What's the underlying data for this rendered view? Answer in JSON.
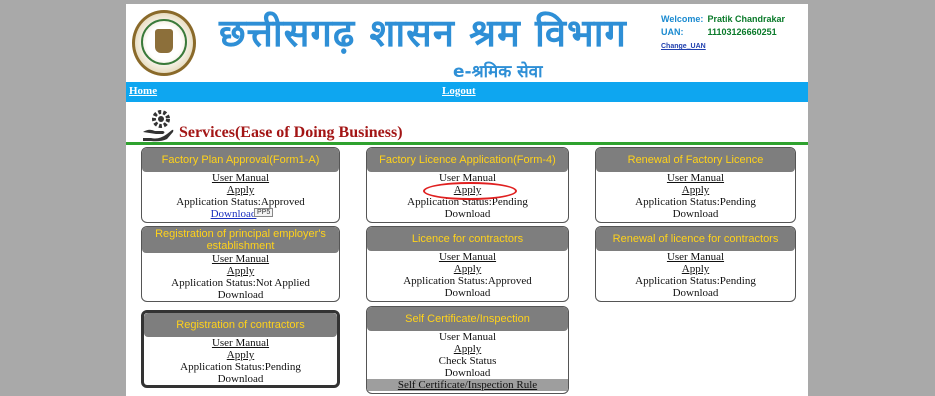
{
  "header": {
    "title_hindi": "छत्तीसगढ़ शासन श्रम विभाग",
    "subtitle_hindi": "e-श्रमिक सेवा",
    "user": {
      "welcome_label": "Welcome:",
      "welcome_name": "Pratik Chandrakar",
      "uan_label": "UAN:",
      "uan_value": "11103126660251",
      "change_uan": "Change_UAN"
    }
  },
  "nav": {
    "home": "Home",
    "logout": "Logout"
  },
  "section": {
    "title": "Services(Ease of Doing Business)"
  },
  "cards": [
    {
      "title": "Factory Plan Approval(Form1-A)",
      "links": [
        "User Manual",
        "Apply"
      ],
      "status": "Application Status:Approved",
      "download": "Download"
    },
    {
      "title": "Factory Licence Application(Form-4)",
      "links": [
        "User Manual",
        "Apply"
      ],
      "status": "Application Status:Pending",
      "download": "Download"
    },
    {
      "title": "Renewal of Factory Licence",
      "links": [
        "User Manual",
        "Apply"
      ],
      "status": "Application Status:Pending",
      "download": "Download"
    },
    {
      "title": "Registration of principal employer's establishment",
      "links": [
        "User Manual",
        "Apply"
      ],
      "status": "Application Status:Not Applied",
      "download": "Download"
    },
    {
      "title": "Licence for contractors",
      "links": [
        "User Manual",
        "Apply"
      ],
      "status": "Application Status:Approved",
      "download": "Download"
    },
    {
      "title": "Renewal of licence for contractors",
      "links": [
        "User Manual",
        "Apply"
      ],
      "status": "Application Status:Pending",
      "download": "Download"
    },
    {
      "title": "Registration of contractors",
      "links": [
        "User Manual",
        "Apply"
      ],
      "status": "Application Status:Pending",
      "download": "Download"
    },
    {
      "title": "Self Certificate/Inspection",
      "links": [
        "User Manual",
        "Apply"
      ],
      "status": "Check Status",
      "download": "Download",
      "extra": "Self Certificate/Inspection Rule"
    }
  ],
  "tooltip": "PP5",
  "colors": {
    "title_blue": "#2e8fd6",
    "nav_bar": "#0ea6f0",
    "card_header": "#7e7e7e",
    "card_header_text": "#ffd21a",
    "section_title": "#a31515",
    "rule_green": "#2fa22f",
    "annotation_red": "#e02020"
  }
}
